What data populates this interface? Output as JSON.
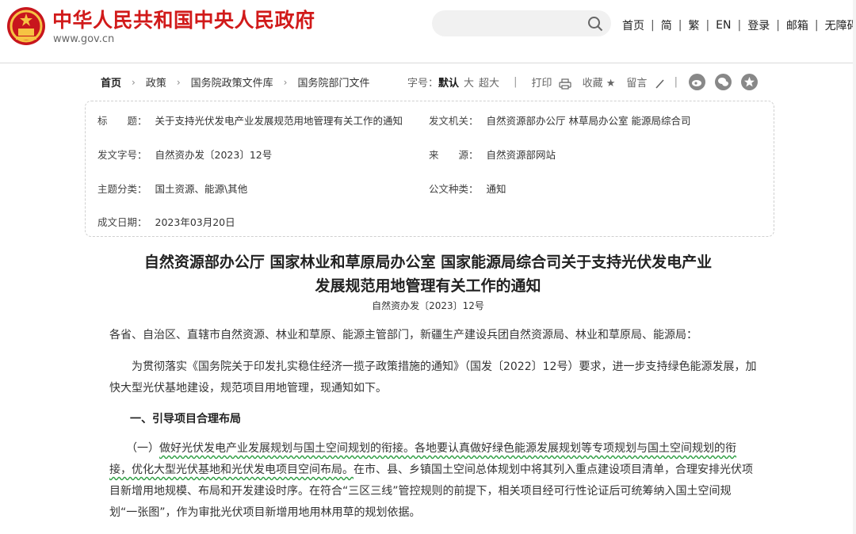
{
  "header": {
    "site_title": "中华人民共和国中央人民政府",
    "site_url": "www.gov.cn",
    "nav": [
      "首页",
      "简",
      "繁",
      "EN",
      "登录",
      "邮箱",
      "无障碍"
    ]
  },
  "breadcrumb": {
    "home": "首页",
    "items": [
      "政策",
      "国务院政策文件库",
      "国务院部门文件"
    ]
  },
  "tools": {
    "font_label": "字号：",
    "font_default": "默认",
    "font_large": "大",
    "font_xlarge": "超大",
    "print": "打印",
    "favorite": "收藏",
    "comment": "留言"
  },
  "meta": {
    "title_label": "标　　题：",
    "title_value": "关于支持光伏发电产业发展规范用地管理有关工作的通知",
    "issuer_label": "发文机关：",
    "issuer_value": "自然资源部办公厅  林草局办公室  能源局综合司",
    "docno_label": "发文字号：",
    "docno_value": "自然资办发〔2023〕12号",
    "source_label": "来　　源：",
    "source_value": "自然资源部网站",
    "topic_label": "主题分类：",
    "topic_value": "国土资源、能源\\其他",
    "type_label": "公文种类：",
    "type_value": "通知",
    "date_label": "成文日期：",
    "date_value": "2023年03月20日"
  },
  "article": {
    "title_line1": "自然资源部办公厅  国家林业和草原局办公室  国家能源局综合司关于支持光伏发电产业",
    "title_line2": "发展规范用地管理有关工作的通知",
    "doc_number": "自然资办发〔2023〕12号",
    "salutation": "各省、自治区、直辖市自然资源、林业和草原、能源主管部门，新疆生产建设兵团自然资源局、林业和草原局、能源局：",
    "intro_line1": "　　为贯彻落实《国务院关于印发扎实稳住经济一揽子政策措施的通知》（国发〔2022〕12号）要求，进一步支持绿色能源发展，加",
    "intro_line2": "快大型光伏基地建设，规范项目用地管理，现通知如下。",
    "section1": "一、引导项目合理布局",
    "p1_prefix": "　　（一）",
    "p1_hl1": "做好光伏发电产业发展规划与国土空间规划的衔接。各地要认真做好绿色能源发展规划等专项规划与国土空间规划的衔",
    "p1_hl2": "接，优化大型光伏基地和光伏发电项目空间布局。",
    "p1_rest_line2": "在市、县、乡镇国土空间总体规划中将其列入重点建设项目清单，合理安排光伏项",
    "p1_line3": "目新增用地规模、布局和开发建设时序。在符合“三区三线”管控规则的前提下，相关项目经可行性论证后可统筹纳入国土空间规",
    "p1_line4": "划“一张图”，作为审批光伏项目新增用地用林用草的规划依据。"
  },
  "colors": {
    "brand_red": "#d11a1a",
    "highlight_underline": "#2f9e44"
  },
  "icons": [
    "national-emblem-icon",
    "search-icon",
    "printer-icon",
    "pencil-icon",
    "weibo-icon",
    "wechat-icon",
    "star-icon"
  ]
}
